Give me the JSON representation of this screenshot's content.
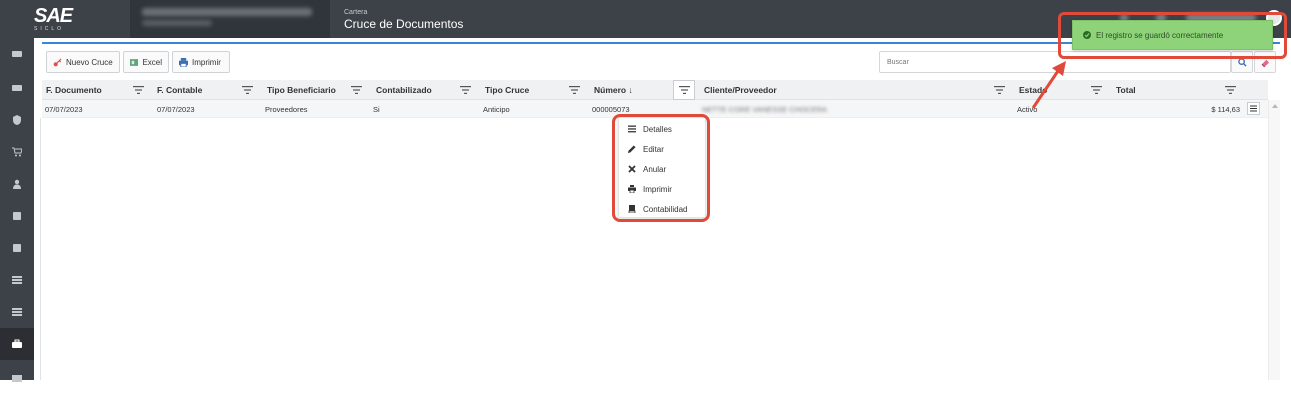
{
  "header": {
    "logo_text": "SAE",
    "logo_sub": "SICLO",
    "breadcrumb_module": "Cartera",
    "page_title": "Cruce de Documentos"
  },
  "toolbar": {
    "new_label": "Nuevo Cruce",
    "excel_label": "Excel",
    "print_label": "Imprimir"
  },
  "search": {
    "placeholder": "Buscar"
  },
  "table": {
    "columns": [
      "F. Documento",
      "F. Contable",
      "Tipo Beneficiario",
      "Contabilizado",
      "Tipo Cruce",
      "Número ↓",
      "Cliente/Proveedor",
      "Estado",
      "Total"
    ],
    "rows": [
      {
        "f_documento": "07/07/2023",
        "f_contable": "07/07/2023",
        "tipo_beneficiario": "Proveedores",
        "contabilizado": "Si",
        "tipo_cruce": "Anticipo",
        "numero": "000005073",
        "cliente_proveedor": "NETTE CORE VANESSE CHOCERA",
        "estado": "Activo",
        "total": "$ 114,63"
      }
    ]
  },
  "context_menu": {
    "items": [
      {
        "label": "Detalles",
        "icon": "list-icon"
      },
      {
        "label": "Editar",
        "icon": "pencil-icon"
      },
      {
        "label": "Anular",
        "icon": "x-icon"
      },
      {
        "label": "Imprimir",
        "icon": "printer-icon"
      },
      {
        "label": "Contabilidad",
        "icon": "book-icon"
      }
    ]
  },
  "toast": {
    "message": "El registro se guardó correctamente"
  },
  "colors": {
    "topbar": "#3d4248",
    "accent": "#3b85d6",
    "toast": "#8ed27a",
    "highlight": "#e04a3a"
  }
}
